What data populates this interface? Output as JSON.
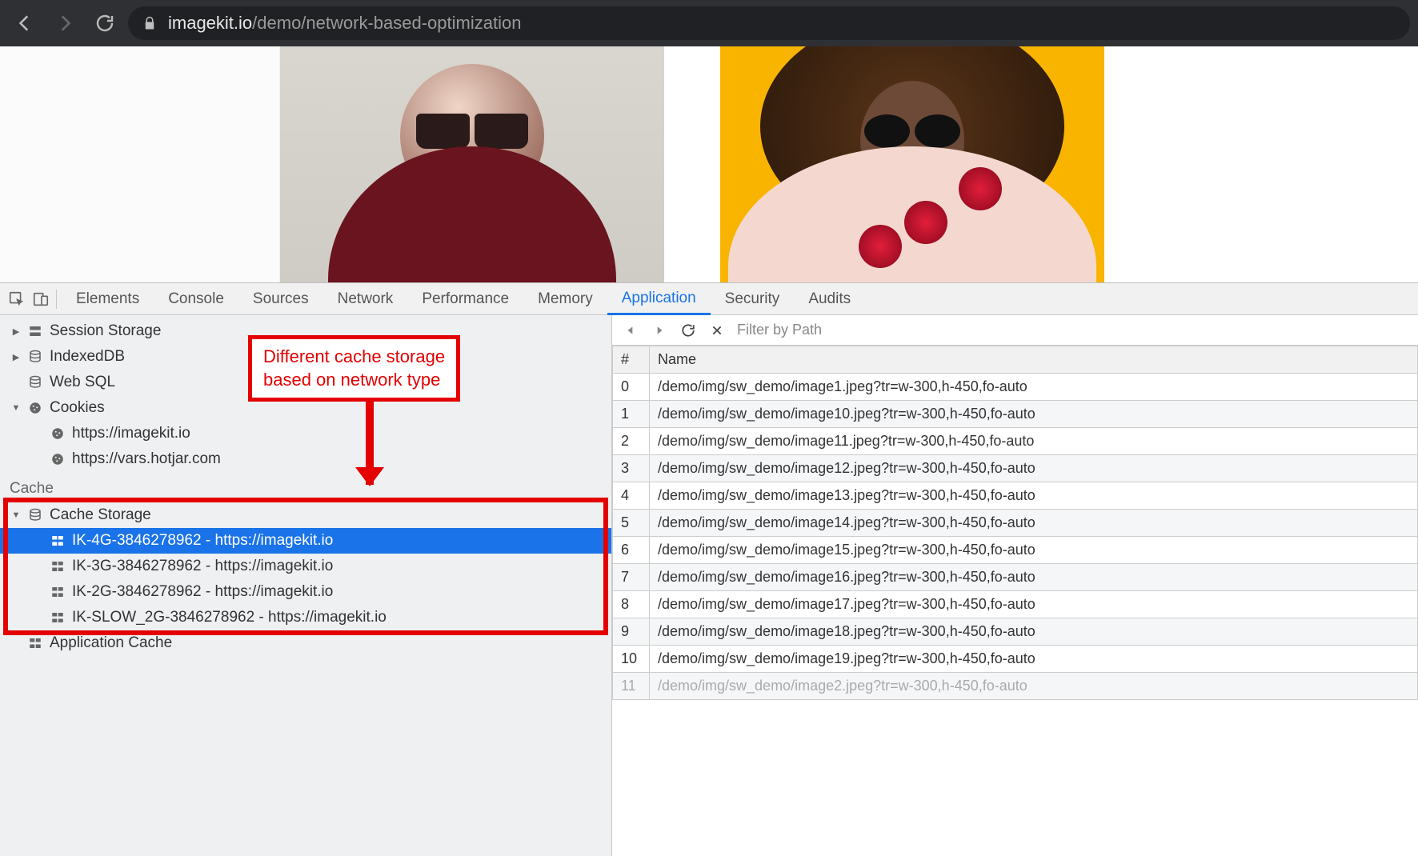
{
  "url": {
    "host": "imagekit.io",
    "path": "/demo/network-based-optimization"
  },
  "devtools_tabs": {
    "elements": "Elements",
    "console": "Console",
    "sources": "Sources",
    "network": "Network",
    "performance": "Performance",
    "memory": "Memory",
    "application": "Application",
    "security": "Security",
    "audits": "Audits"
  },
  "sidebar": {
    "session_storage": "Session Storage",
    "indexeddb": "IndexedDB",
    "web_sql": "Web SQL",
    "cookies": "Cookies",
    "cookies_items": {
      "0": "https://imagekit.io",
      "1": "https://vars.hotjar.com"
    },
    "cache_section": "Cache",
    "cache_storage": "Cache Storage",
    "application_cache": "Application Cache",
    "caches": {
      "0": "IK-4G-3846278962 - https://imagekit.io",
      "1": "IK-3G-3846278962 - https://imagekit.io",
      "2": "IK-2G-3846278962 - https://imagekit.io",
      "3": "IK-SLOW_2G-3846278962 - https://imagekit.io"
    }
  },
  "annotation": {
    "line1": "Different cache storage",
    "line2": "based on network type"
  },
  "right": {
    "filter_placeholder": "Filter by Path",
    "col_index": "#",
    "col_name": "Name",
    "rows": {
      "0": {
        "i": "0",
        "n": "/demo/img/sw_demo/image1.jpeg?tr=w-300,h-450,fo-auto"
      },
      "1": {
        "i": "1",
        "n": "/demo/img/sw_demo/image10.jpeg?tr=w-300,h-450,fo-auto"
      },
      "2": {
        "i": "2",
        "n": "/demo/img/sw_demo/image11.jpeg?tr=w-300,h-450,fo-auto"
      },
      "3": {
        "i": "3",
        "n": "/demo/img/sw_demo/image12.jpeg?tr=w-300,h-450,fo-auto"
      },
      "4": {
        "i": "4",
        "n": "/demo/img/sw_demo/image13.jpeg?tr=w-300,h-450,fo-auto"
      },
      "5": {
        "i": "5",
        "n": "/demo/img/sw_demo/image14.jpeg?tr=w-300,h-450,fo-auto"
      },
      "6": {
        "i": "6",
        "n": "/demo/img/sw_demo/image15.jpeg?tr=w-300,h-450,fo-auto"
      },
      "7": {
        "i": "7",
        "n": "/demo/img/sw_demo/image16.jpeg?tr=w-300,h-450,fo-auto"
      },
      "8": {
        "i": "8",
        "n": "/demo/img/sw_demo/image17.jpeg?tr=w-300,h-450,fo-auto"
      },
      "9": {
        "i": "9",
        "n": "/demo/img/sw_demo/image18.jpeg?tr=w-300,h-450,fo-auto"
      },
      "10": {
        "i": "10",
        "n": "/demo/img/sw_demo/image19.jpeg?tr=w-300,h-450,fo-auto"
      },
      "11": {
        "i": "11",
        "n": "/demo/img/sw_demo/image2.jpeg?tr=w-300,h-450,fo-auto"
      }
    }
  }
}
